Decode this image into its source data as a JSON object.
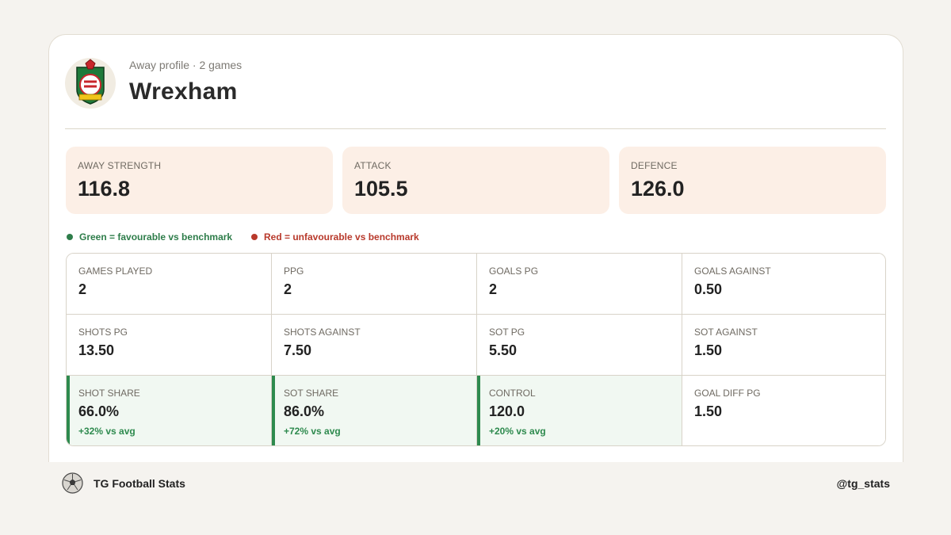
{
  "header": {
    "subtitle": "Away profile · 2 games",
    "team_name": "Wrexham"
  },
  "tiles": [
    {
      "label": "AWAY STRENGTH",
      "value": "116.8"
    },
    {
      "label": "ATTACK",
      "value": "105.5"
    },
    {
      "label": "DEFENCE",
      "value": "126.0"
    }
  ],
  "legend": {
    "good": {
      "label": "Green = favourable vs benchmark",
      "color": "#2e7d4a"
    },
    "bad": {
      "label": "Red = unfavourable vs benchmark",
      "color": "#b8392b"
    }
  },
  "stats": [
    {
      "label": "GAMES PLAYED",
      "value": "2",
      "delta": ""
    },
    {
      "label": "PPG",
      "value": "2",
      "delta": ""
    },
    {
      "label": "GOALS PG",
      "value": "2",
      "delta": ""
    },
    {
      "label": "GOALS AGAINST",
      "value": "0.50",
      "delta": ""
    },
    {
      "label": "SHOTS PG",
      "value": "13.50",
      "delta": ""
    },
    {
      "label": "SHOTS AGAINST",
      "value": "7.50",
      "delta": ""
    },
    {
      "label": "SOT PG",
      "value": "5.50",
      "delta": ""
    },
    {
      "label": "SOT AGAINST",
      "value": "1.50",
      "delta": ""
    },
    {
      "label": "SHOT SHARE",
      "value": "66.0%",
      "delta": "+32% vs avg"
    },
    {
      "label": "SOT SHARE",
      "value": "86.0%",
      "delta": "+72% vs avg"
    },
    {
      "label": "CONTROL",
      "value": "120.0",
      "delta": "+20% vs avg"
    },
    {
      "label": "GOAL DIFF PG",
      "value": "1.50",
      "delta": ""
    }
  ],
  "footer": {
    "brand": "TG Football Stats",
    "handle": "@tg_stats"
  },
  "colors": {
    "favourable": "#2e8a4e",
    "tile_bg": "#fcefe6",
    "highlight_bg": "#f1f8f2"
  },
  "icons": {
    "crest": "wrexham-crest-icon",
    "footer_logo": "football-icon"
  }
}
